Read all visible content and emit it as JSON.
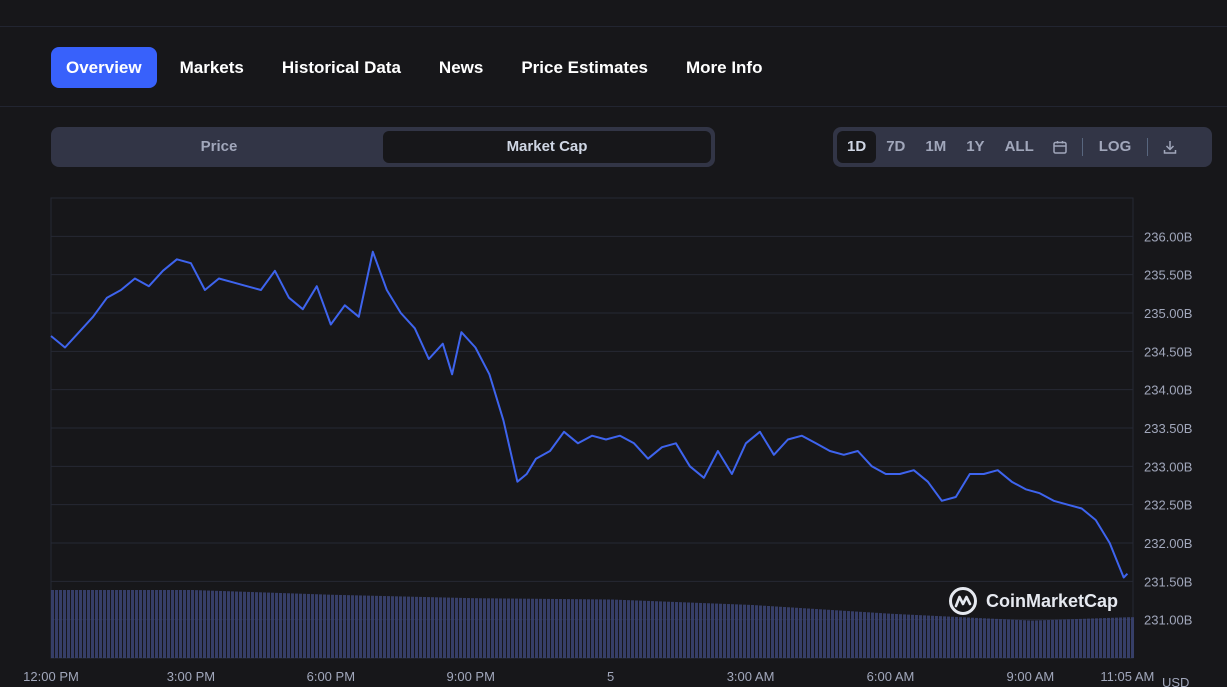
{
  "tabs": [
    {
      "label": "Overview",
      "active": true
    },
    {
      "label": "Markets",
      "active": false
    },
    {
      "label": "Historical Data",
      "active": false
    },
    {
      "label": "News",
      "active": false
    },
    {
      "label": "Price Estimates",
      "active": false
    },
    {
      "label": "More Info",
      "active": false
    }
  ],
  "toggle": {
    "price_label": "Price",
    "market_cap_label": "Market Cap",
    "selected": "Market Cap"
  },
  "ranges": {
    "d1": "1D",
    "d7": "7D",
    "m1": "1M",
    "y1": "1Y",
    "all": "ALL",
    "selected": "1D",
    "log_label": "LOG",
    "calendar_icon": "calendar-icon",
    "download_icon": "download-icon"
  },
  "watermark": {
    "text": "CoinMarketCap",
    "logo_icon": "coinmarketcap-logo-icon"
  },
  "colors": {
    "accent": "#3861fb",
    "line": "#3e64ee",
    "volume": "#3a4270",
    "background": "#17171a",
    "panel": "#323546"
  },
  "chart_data": {
    "type": "line",
    "title": "",
    "ylabel": "",
    "xlabel": "",
    "y_unit": "USD",
    "ylim": [
      230.5,
      236.5
    ],
    "y_ticks": [
      {
        "v": 231.0,
        "label": "231.00B"
      },
      {
        "v": 231.5,
        "label": "231.50B"
      },
      {
        "v": 232.0,
        "label": "232.00B"
      },
      {
        "v": 232.5,
        "label": "232.50B"
      },
      {
        "v": 233.0,
        "label": "233.00B"
      },
      {
        "v": 233.5,
        "label": "233.50B"
      },
      {
        "v": 234.0,
        "label": "234.00B"
      },
      {
        "v": 234.5,
        "label": "234.50B"
      },
      {
        "v": 235.0,
        "label": "235.00B"
      },
      {
        "v": 235.5,
        "label": "235.50B"
      },
      {
        "v": 236.0,
        "label": "236.00B"
      }
    ],
    "xlim": [
      12,
      35.2
    ],
    "x_ticks": [
      {
        "t": 12,
        "label": "12:00 PM"
      },
      {
        "t": 15,
        "label": "3:00 PM"
      },
      {
        "t": 18,
        "label": "6:00 PM"
      },
      {
        "t": 21,
        "label": "9:00 PM"
      },
      {
        "t": 24,
        "label": "5"
      },
      {
        "t": 27,
        "label": "3:00 AM"
      },
      {
        "t": 30,
        "label": "6:00 AM"
      },
      {
        "t": 33,
        "label": "9:00 AM"
      },
      {
        "t": 35.08,
        "label": "11:05 AM"
      }
    ],
    "grid": true,
    "series": [
      {
        "name": "",
        "t": [
          12.0,
          12.3,
          12.6,
          12.9,
          13.2,
          13.5,
          13.8,
          14.1,
          14.4,
          14.7,
          15.0,
          15.3,
          15.6,
          15.9,
          16.2,
          16.5,
          16.8,
          17.1,
          17.4,
          17.7,
          18.0,
          18.3,
          18.6,
          18.9,
          19.2,
          19.5,
          19.8,
          20.1,
          20.4,
          20.6,
          20.8,
          21.1,
          21.4,
          21.7,
          22.0,
          22.2,
          22.4,
          22.7,
          23.0,
          23.3,
          23.6,
          23.9,
          24.2,
          24.5,
          24.8,
          25.1,
          25.4,
          25.7,
          26.0,
          26.3,
          26.6,
          26.9,
          27.2,
          27.5,
          27.8,
          28.1,
          28.4,
          28.7,
          29.0,
          29.3,
          29.6,
          29.9,
          30.2,
          30.5,
          30.8,
          31.1,
          31.4,
          31.7,
          32.0,
          32.3,
          32.6,
          32.9,
          33.2,
          33.5,
          33.8,
          34.1,
          34.4,
          34.7,
          34.9,
          35.0,
          35.08
        ],
        "values": [
          234.7,
          234.55,
          234.75,
          234.95,
          235.2,
          235.3,
          235.45,
          235.35,
          235.55,
          235.7,
          235.65,
          235.3,
          235.45,
          235.4,
          235.35,
          235.3,
          235.55,
          235.2,
          235.05,
          235.35,
          234.85,
          235.1,
          234.95,
          235.8,
          235.3,
          235.0,
          234.8,
          234.4,
          234.6,
          234.2,
          234.75,
          234.55,
          234.2,
          233.6,
          232.8,
          232.9,
          233.1,
          233.2,
          233.45,
          233.3,
          233.4,
          233.35,
          233.4,
          233.3,
          233.1,
          233.25,
          233.3,
          233.0,
          232.85,
          233.2,
          232.9,
          233.3,
          233.45,
          233.15,
          233.35,
          233.4,
          233.3,
          233.2,
          233.15,
          233.2,
          233.0,
          232.9,
          232.9,
          232.95,
          232.8,
          232.55,
          232.6,
          232.9,
          232.9,
          232.95,
          232.8,
          232.7,
          232.65,
          232.55,
          232.5,
          232.45,
          232.3,
          232.0,
          231.7,
          231.55,
          231.6
        ]
      }
    ],
    "volume": {
      "note": "",
      "t": [
        12,
        15,
        18,
        21,
        24,
        27,
        30,
        33,
        35.08
      ],
      "values": [
        1.0,
        1.0,
        0.93,
        0.88,
        0.86,
        0.78,
        0.65,
        0.55,
        0.6
      ]
    }
  }
}
